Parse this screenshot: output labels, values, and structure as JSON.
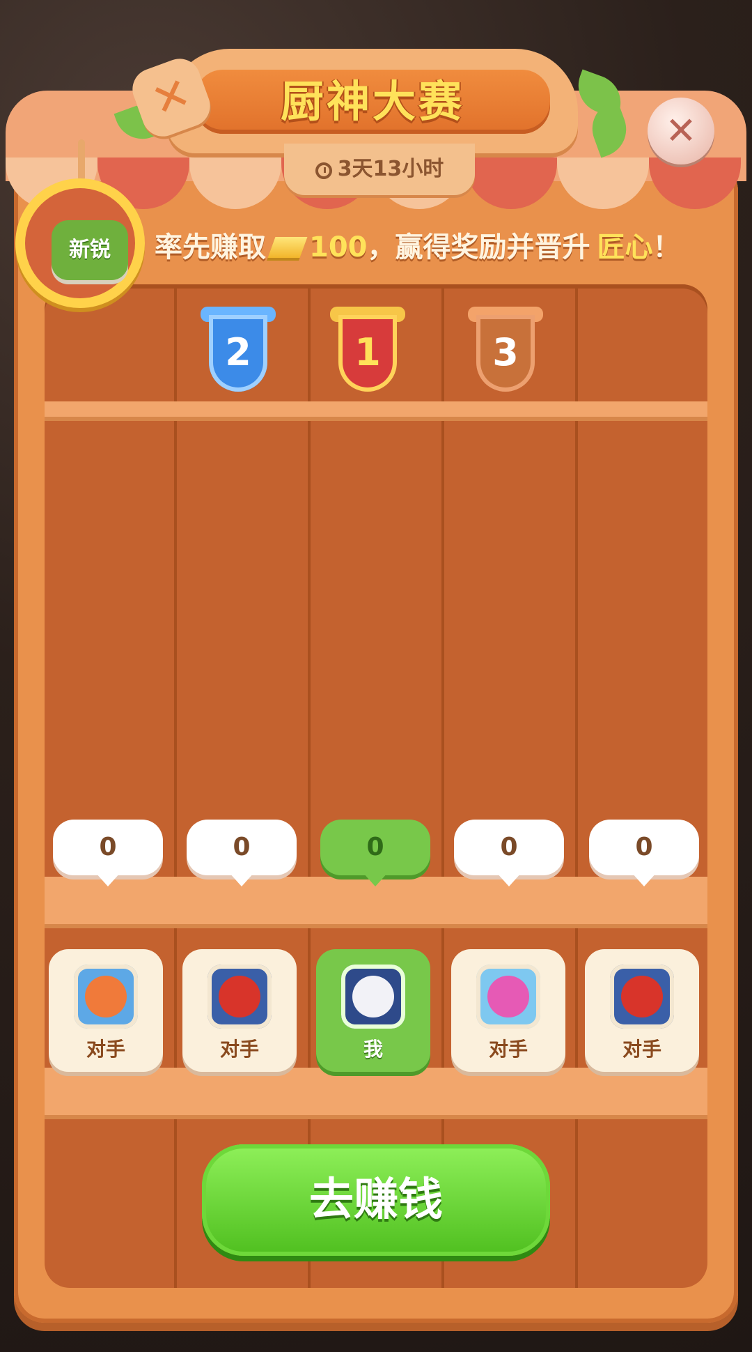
{
  "header": {
    "title": "厨神大赛",
    "timer": "3天13小时",
    "close_label": "✕"
  },
  "rank_badge": {
    "label": "新锐"
  },
  "goal": {
    "prefix": "率先赚取",
    "amount": "100",
    "middle": "，赢得奖励并晋升",
    "rank": "匠心",
    "suffix": "！"
  },
  "podium": [
    {
      "place": "2",
      "style": "blue"
    },
    {
      "place": "1",
      "style": "red"
    },
    {
      "place": "3",
      "style": "bronze"
    }
  ],
  "players": [
    {
      "score": "0",
      "label": "对手",
      "is_me": false,
      "avatar": "orange-crab",
      "color": "#f07a3a"
    },
    {
      "score": "0",
      "label": "对手",
      "is_me": false,
      "avatar": "red-devil",
      "color": "#d8342a"
    },
    {
      "score": "0",
      "label": "我",
      "is_me": true,
      "avatar": "ghost",
      "color": "#f2f2f7"
    },
    {
      "score": "0",
      "label": "对手",
      "is_me": false,
      "avatar": "pink-octopus",
      "color": "#e65ab5"
    },
    {
      "score": "0",
      "label": "对手",
      "is_me": false,
      "avatar": "red-devil",
      "color": "#d8342a"
    }
  ],
  "action": {
    "label": "去赚钱"
  }
}
